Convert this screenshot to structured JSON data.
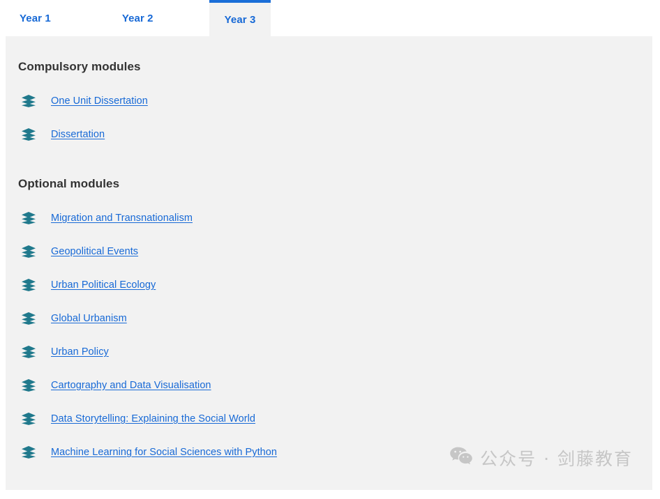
{
  "tabs": [
    {
      "label": "Year 1",
      "active": false
    },
    {
      "label": "Year 2",
      "active": false
    },
    {
      "label": "Year 3",
      "active": true
    }
  ],
  "sections": [
    {
      "heading": "Compulsory modules",
      "modules": [
        "One Unit Dissertation",
        "Dissertation"
      ]
    },
    {
      "heading": "Optional modules",
      "modules": [
        "Migration and Transnationalism",
        "Geopolitical Events",
        "Urban Political Ecology",
        "Global Urbanism",
        "Urban Policy",
        "Cartography and Data Visualisation",
        "Data Storytelling: Explaining the Social World",
        "Machine Learning for Social Sciences with Python"
      ]
    }
  ],
  "watermark": {
    "text": "公众号 · 剑藤教育",
    "icon": "wechat-icon"
  },
  "colors": {
    "link": "#1769d6",
    "tab_active_border": "#1a6ed8",
    "icon_teal": "#20798c",
    "panel_bg": "#f2f2f2",
    "heading": "#333333",
    "watermark": "#c6c6c6"
  }
}
